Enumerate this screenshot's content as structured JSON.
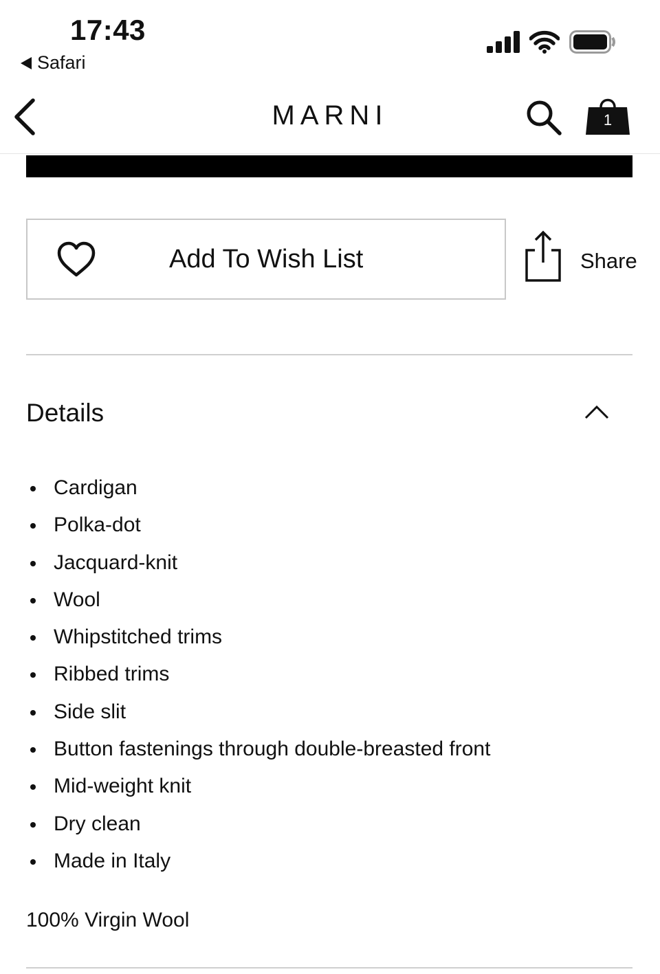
{
  "status_bar": {
    "time": "17:43",
    "back_app": "Safari",
    "icons": [
      "signal-icon",
      "wifi-icon",
      "battery-icon"
    ]
  },
  "header": {
    "brand": "MARNI",
    "bag_count": "1",
    "icons": [
      "back-chevron-icon",
      "search-icon",
      "shopping-bag-icon"
    ]
  },
  "actions": {
    "wishlist_label": "Add To Wish List",
    "share_label": "Share"
  },
  "details": {
    "title": "Details",
    "items": [
      "Cardigan",
      "Polka-dot",
      "Jacquard-knit",
      "Wool",
      "Whipstitched trims",
      "Ribbed trims",
      "Side slit",
      "Button fastenings through double-breasted front",
      "Mid-weight knit",
      "Dry clean",
      "Made in Italy"
    ],
    "composition": "100% Virgin Wool"
  },
  "colors": {
    "text": "#111111",
    "border": "#c8c8c8",
    "divider": "#cfcfcf",
    "background": "#ffffff"
  }
}
